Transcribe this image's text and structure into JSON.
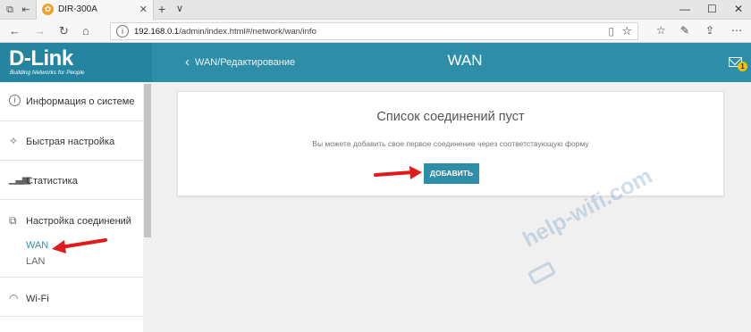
{
  "browser": {
    "tab_title": "DIR-300A",
    "tab_close": "✕",
    "new_tab": "+",
    "tab_menu": "∨",
    "url_host": "192.168.0.1",
    "url_path": "/admin/index.html#/network/wan/info",
    "win_min": "—",
    "win_max": "☐",
    "win_close": "✕"
  },
  "header": {
    "logo": "D-Link",
    "tagline": "Building Networks for People",
    "back_label": "WAN/Редактирование",
    "title": "WAN",
    "notification_count": "1"
  },
  "sidebar": {
    "items": [
      {
        "label": "Информация о системе"
      },
      {
        "label": "Быстрая настройка"
      },
      {
        "label": "Статистика"
      },
      {
        "label": "Настройка соединений"
      },
      {
        "label": "Wi-Fi"
      }
    ],
    "sub_items": [
      {
        "label": "WAN",
        "active": true
      },
      {
        "label": "LAN",
        "active": false
      }
    ]
  },
  "main": {
    "empty_title": "Список соединений пуст",
    "empty_description": "Вы можете добавить свое первое соединение через соответствующую форму",
    "add_button": "ДОБАВИТЬ"
  },
  "watermark": "help-wifi.com",
  "colors": {
    "accent": "#2e8ea8",
    "active_link": "#2e8ea8",
    "arrow": "#e01b1b",
    "badge": "#f2c200"
  }
}
